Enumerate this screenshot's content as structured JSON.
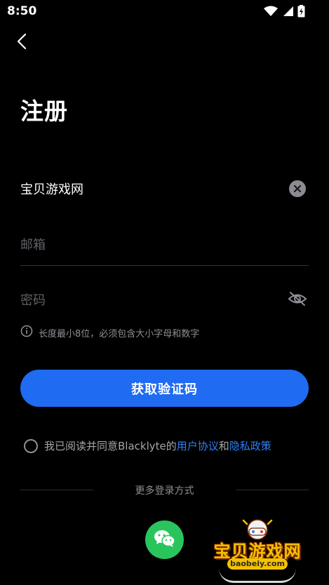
{
  "status_bar": {
    "time": "8:50",
    "icons": [
      "wifi-icon",
      "cellular-signal-icon",
      "battery-charging-icon"
    ]
  },
  "header": {
    "back_icon": "chevron-left-icon"
  },
  "page": {
    "title": "注册"
  },
  "form": {
    "username": {
      "value": "宝贝游戏网",
      "clear_icon": "clear-circle-icon"
    },
    "email": {
      "value": "",
      "placeholder": "邮箱"
    },
    "password": {
      "value": "",
      "placeholder": "密码",
      "toggle_icon": "eye-off-icon"
    },
    "hint": {
      "icon": "info-icon",
      "text": "长度最小8位，必须包含大小字母和数字"
    },
    "submit_label": "获取验证码"
  },
  "agreement": {
    "prefix": "我已阅读并同意Blacklyte的",
    "terms_link": "用户协议",
    "conjunction": "和",
    "privacy_link": "隐私政策",
    "checked": false
  },
  "alt_login": {
    "label": "更多登录方式",
    "wechat_icon": "wechat-icon"
  },
  "watermark": {
    "title": "宝贝游戏网",
    "url": "baobeiy.com"
  },
  "colors": {
    "background": "#000000",
    "primary": "#1f6bf2",
    "link": "#2f7ef5",
    "wechat": "#2ac45d",
    "muted_text": "#8e9095"
  }
}
